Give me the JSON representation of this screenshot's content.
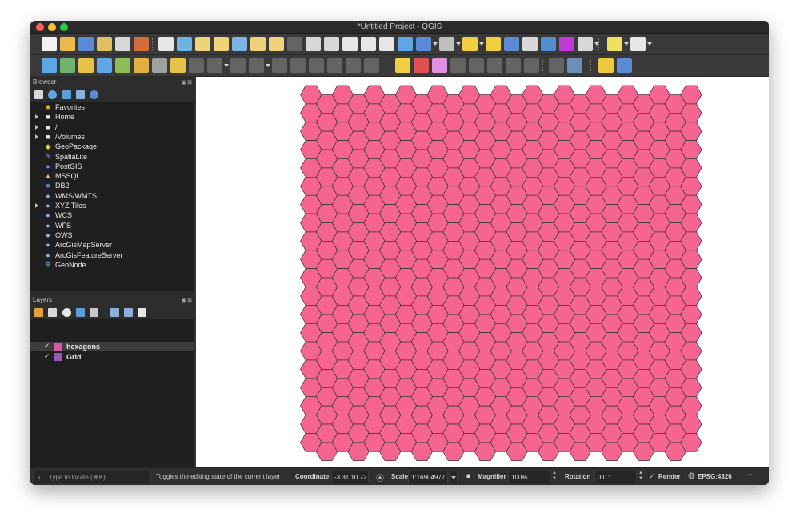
{
  "window": {
    "title": "*Untitled Project - QGIS"
  },
  "toolbar_row1": [
    {
      "id": "new-project",
      "color": "#f2f2f2"
    },
    {
      "id": "open-project",
      "color": "#e9b949"
    },
    {
      "id": "save-project",
      "color": "#5b8bd4"
    },
    {
      "id": "new-print-layout",
      "color": "#e0c060"
    },
    {
      "id": "show-layout-manager",
      "color": "#d8d8d8"
    },
    {
      "id": "style-manager",
      "color": "#d46d3b"
    },
    {
      "id": "pan-map",
      "color": "#e6e6e6"
    },
    {
      "id": "pan-to-selection",
      "color": "#6fb3e0"
    },
    {
      "id": "zoom-in",
      "color": "#f0d27a"
    },
    {
      "id": "zoom-out",
      "color": "#f0d27a"
    },
    {
      "id": "zoom-full",
      "color": "#7fb2e5"
    },
    {
      "id": "zoom-to-selection",
      "color": "#f0d27a"
    },
    {
      "id": "zoom-to-layer",
      "color": "#f0d27a"
    },
    {
      "id": "zoom-native",
      "color": "#9a9a9a"
    },
    {
      "id": "zoom-last",
      "color": "#d8d8d8"
    },
    {
      "id": "zoom-next",
      "color": "#d8d8d8"
    },
    {
      "id": "new-map-view",
      "color": "#e6e6e6"
    },
    {
      "id": "new-3d-map",
      "color": "#e6e6e6"
    },
    {
      "id": "temporal-controller",
      "color": "#e6e6e6"
    },
    {
      "id": "refresh",
      "color": "#5fa6e6"
    },
    {
      "id": "identify-features",
      "color": "#5b8bd4"
    },
    {
      "id": "actions",
      "color": "#bfbfbf"
    },
    {
      "id": "select-features",
      "color": "#f0d040"
    },
    {
      "id": "deselect",
      "color": "#f0d040"
    },
    {
      "id": "open-attribute-table",
      "color": "#5b8bd4"
    },
    {
      "id": "statistical-summary",
      "color": "#d8d8d8"
    },
    {
      "id": "toolbox",
      "color": "#4f8fcf"
    },
    {
      "id": "sum-stats",
      "color": "#c03ad6"
    },
    {
      "id": "measure",
      "color": "#d8d8d8"
    },
    {
      "id": "map-tips",
      "color": "#f0e060"
    },
    {
      "id": "text-annotation",
      "color": "#e6e6e6"
    }
  ],
  "toolbar_row2": [
    {
      "id": "data-source-manager",
      "color": "#5fa6e6"
    },
    {
      "id": "new-geopackage",
      "color": "#6fb36f"
    },
    {
      "id": "digitize-current-layer",
      "color": "#e6c24a"
    },
    {
      "id": "add-vector",
      "color": "#5fa6e6"
    },
    {
      "id": "add-raster",
      "color": "#8bbf5a"
    },
    {
      "id": "toggle-editing",
      "color": "#e0b040"
    },
    {
      "id": "current-edits",
      "color": "#a0a0a0"
    },
    {
      "id": "digitize",
      "color": "#e6c24a"
    },
    {
      "id": "save-edits",
      "color": "#9a9a9a"
    },
    {
      "id": "add-feature",
      "color": "#9a9a9a"
    },
    {
      "id": "vertex-tool",
      "color": "#9a9a9a"
    },
    {
      "id": "modify-attributes",
      "color": "#9a9a9a"
    },
    {
      "id": "delete-selected",
      "color": "#9a9a9a"
    },
    {
      "id": "cut-features",
      "color": "#9a9a9a"
    },
    {
      "id": "copy-features",
      "color": "#9a9a9a"
    },
    {
      "id": "paste-features",
      "color": "#9a9a9a"
    },
    {
      "id": "undo",
      "color": "#9a9a9a"
    },
    {
      "id": "redo",
      "color": "#9a9a9a"
    },
    {
      "id": "label-tool",
      "color": "#f0d040"
    },
    {
      "id": "label-highlight",
      "color": "#e05050"
    },
    {
      "id": "label-pin",
      "color": "#e090e0"
    },
    {
      "id": "label-show-hide",
      "color": "#9a9a9a"
    },
    {
      "id": "label-move",
      "color": "#9a9a9a"
    },
    {
      "id": "label-rotate",
      "color": "#9a9a9a"
    },
    {
      "id": "label-change",
      "color": "#9a9a9a"
    },
    {
      "id": "label-diagram",
      "color": "#9a9a9a"
    },
    {
      "id": "label-callout",
      "color": "#9a9a9a"
    },
    {
      "id": "globe",
      "color": "#6a8fb8"
    },
    {
      "id": "python-console",
      "color": "#f0c840"
    },
    {
      "id": "help",
      "color": "#5b8bd4"
    }
  ],
  "browser": {
    "title": "Browser",
    "items": [
      {
        "label": "Favorites",
        "icon": "star-icon",
        "glyph": "★",
        "color": "#f0c420",
        "expand": false
      },
      {
        "label": "Home",
        "icon": "home-folder-icon",
        "glyph": "■",
        "color": "#e6e6e6",
        "expand": true
      },
      {
        "label": "/",
        "icon": "folder-icon",
        "glyph": "■",
        "color": "#e6e6e6",
        "expand": true
      },
      {
        "label": "/Volumes",
        "icon": "folder-icon",
        "glyph": "■",
        "color": "#e6e6e6",
        "expand": true
      },
      {
        "label": "GeoPackage",
        "icon": "geopackage-icon",
        "glyph": "◆",
        "color": "#e9c84a",
        "expand": false
      },
      {
        "label": "SpatiaLite",
        "icon": "spatialite-icon",
        "glyph": "✎",
        "color": "#6fa8e0",
        "expand": false
      },
      {
        "label": "PostGIS",
        "icon": "postgis-icon",
        "glyph": "●",
        "color": "#5c8fc8",
        "expand": false
      },
      {
        "label": "MSSQL",
        "icon": "mssql-icon",
        "glyph": "▲",
        "color": "#c8c8c8",
        "expand": false
      },
      {
        "label": "DB2",
        "icon": "db2-icon",
        "glyph": "■",
        "color": "#4a7fc0",
        "expand": false
      },
      {
        "label": "WMS/WMTS",
        "icon": "wms-globe-icon",
        "glyph": "●",
        "color": "#7fb0e0",
        "expand": false
      },
      {
        "label": "XYZ Tiles",
        "icon": "xyz-globe-icon",
        "glyph": "●",
        "color": "#7fb0e0",
        "expand": true
      },
      {
        "label": "WCS",
        "icon": "wcs-globe-icon",
        "glyph": "●",
        "color": "#7fb0e0",
        "expand": false
      },
      {
        "label": "WFS",
        "icon": "wfs-globe-icon",
        "glyph": "●",
        "color": "#7fb0e0",
        "expand": false
      },
      {
        "label": "OWS",
        "icon": "ows-globe-icon",
        "glyph": "●",
        "color": "#9bbad8",
        "expand": false
      },
      {
        "label": "ArcGisMapServer",
        "icon": "arcgis-map-icon",
        "glyph": "●",
        "color": "#7fb0e0",
        "expand": false
      },
      {
        "label": "ArcGisFeatureServer",
        "icon": "arcgis-feature-icon",
        "glyph": "●",
        "color": "#7fb0e0",
        "expand": false
      },
      {
        "label": "GeoNode",
        "icon": "geonode-icon",
        "glyph": "✲",
        "color": "#6fb0e0",
        "expand": false
      }
    ]
  },
  "layers": {
    "title": "Layers",
    "items": [
      {
        "label": "hexagons",
        "checked": "✓",
        "color": "#d65aa6",
        "selected": true
      },
      {
        "label": "Grid",
        "checked": "✓",
        "color": "#a055b8",
        "selected": false
      }
    ]
  },
  "map": {
    "fill_color": "#f56590",
    "stroke_color": "#333333",
    "background": "#ffffff"
  },
  "status": {
    "locate_placeholder": "Type to locate (⌘K)",
    "message": "Toggles the editing state of the current layer",
    "coordinate_label": "Coordinate",
    "coordinate_value": "-3.31,10.72",
    "scale_label": "Scale",
    "scale_value": "1:16904977",
    "magnifier_label": "Magnifier",
    "magnifier_value": "100%",
    "rotation_label": "Rotation",
    "rotation_value": "0.0 °",
    "render_check": "✓",
    "render_label": "Render",
    "crs_label": "EPSG:4326"
  }
}
